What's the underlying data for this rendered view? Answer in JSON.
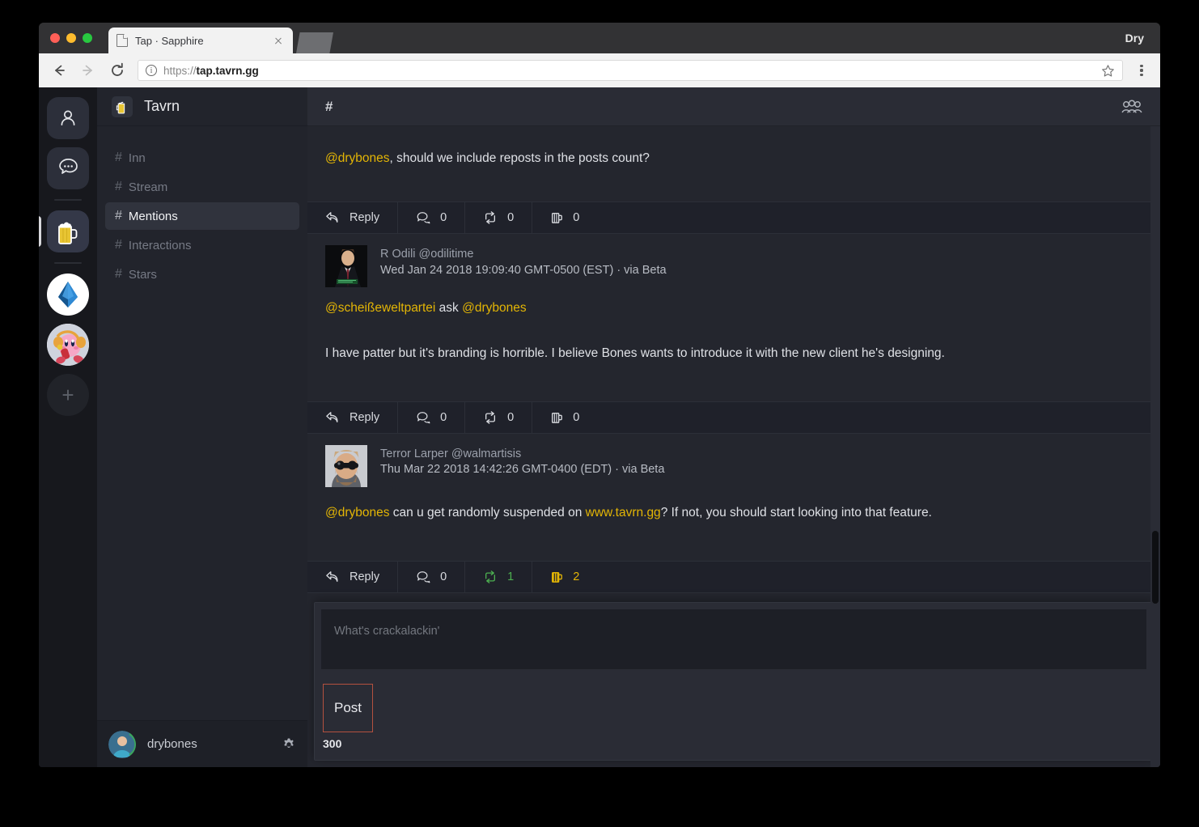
{
  "browser": {
    "tab_title": "Tap · Sapphire",
    "url_prefix": "https://",
    "url_bold": "tap.tavrn.gg",
    "window_label": "Dry",
    "icons": {
      "favicon": "document-icon",
      "close": "close-icon",
      "back": "back-arrow-icon",
      "forward": "forward-arrow-icon",
      "reload": "reload-icon",
      "info": "info-icon",
      "star": "star-icon",
      "menu": "kebab-menu-icon"
    }
  },
  "rail": {
    "items": [
      {
        "name": "profile-icon",
        "label": "Profile"
      },
      {
        "name": "messages-icon",
        "label": "Messages"
      },
      {
        "name": "tavrn-beer-icon",
        "label": "Tavrn",
        "selected": true
      },
      {
        "name": "sapphire-drop-icon",
        "label": "Sapphire"
      },
      {
        "name": "kirby-avatar-icon",
        "label": "Kirby"
      },
      {
        "name": "add-server-icon",
        "label": "+"
      }
    ],
    "add_label": "+"
  },
  "sidebar": {
    "guild_name": "Tavrn",
    "guild_icon": "beer-mug-icon",
    "channels": [
      {
        "hash": "#",
        "label": "Inn",
        "active": false
      },
      {
        "hash": "#",
        "label": "Stream",
        "active": false
      },
      {
        "hash": "#",
        "label": "Mentions",
        "active": true
      },
      {
        "hash": "#",
        "label": "Interactions",
        "active": false
      },
      {
        "hash": "#",
        "label": "Stars",
        "active": false
      }
    ],
    "user": {
      "name": "drybones",
      "settings_icon": "gear-icon"
    }
  },
  "main": {
    "header": {
      "channel_hash": "#",
      "members_icon": "members-icon"
    },
    "posts": [
      {
        "id": "post-1",
        "has_author": false,
        "body": [
          {
            "type": "mention",
            "text": "@drybones"
          },
          {
            "type": "text",
            "text": ", should we include reposts in the posts count?"
          }
        ],
        "actions": {
          "reply_label": "Reply",
          "replies": "0",
          "reposts": "0",
          "beers": "0",
          "reposts_active": false,
          "beers_active": false
        }
      },
      {
        "id": "post-2",
        "has_author": true,
        "author_name": "R Odili @odilitime",
        "author_time": "Wed Jan 24 2018 19:09:40 GMT-0500 (EST) · via Beta",
        "avatar": "odilitime-avatar",
        "body": [
          {
            "type": "mention",
            "text": "@scheißeweltpartei"
          },
          {
            "type": "text",
            "text": " ask "
          },
          {
            "type": "mention",
            "text": "@drybones"
          }
        ],
        "body2": [
          {
            "type": "text",
            "text": "I have patter but it's branding is horrible. I believe Bones wants to introduce it with the new client he's designing."
          }
        ],
        "actions": {
          "reply_label": "Reply",
          "replies": "0",
          "reposts": "0",
          "beers": "0",
          "reposts_active": false,
          "beers_active": false
        }
      },
      {
        "id": "post-3",
        "has_author": true,
        "author_name": "Terror Larper @walmartisis",
        "author_time": "Thu Mar 22 2018 14:42:26 GMT-0400 (EDT) · via Beta",
        "avatar": "walmartisis-avatar",
        "body": [
          {
            "type": "mention",
            "text": "@drybones"
          },
          {
            "type": "text",
            "text": " can u get randomly suspended on "
          },
          {
            "type": "link",
            "text": "www.tavrn.gg"
          },
          {
            "type": "text",
            "text": "? If not, you should start looking into that feature."
          }
        ],
        "actions": {
          "reply_label": "Reply",
          "replies": "0",
          "reposts": "1",
          "beers": "2",
          "reposts_active": true,
          "beers_active": true
        }
      }
    ],
    "compose": {
      "placeholder": "What's crackalackin'",
      "post_button": "Post",
      "char_count": "300"
    }
  },
  "colors": {
    "accent_gold": "#e3b505",
    "repost_green": "#4caf50",
    "post_border": "#b4513f",
    "app_bg": "#24262e",
    "rail_bg": "#17181d",
    "sidebar_bg": "#22242c"
  }
}
